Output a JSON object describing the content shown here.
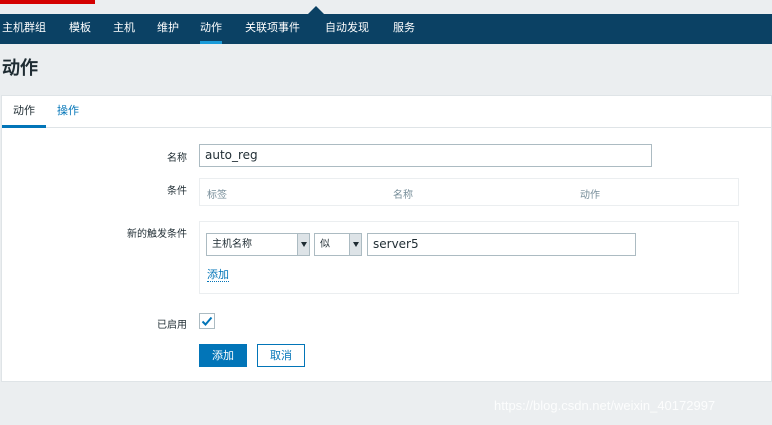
{
  "nav": {
    "items": [
      {
        "label": "主机群组",
        "active": false
      },
      {
        "label": "模板",
        "active": false
      },
      {
        "label": "主机",
        "active": false
      },
      {
        "label": "维护",
        "active": false
      },
      {
        "label": "动作",
        "active": true
      },
      {
        "label": "关联项事件",
        "active": false
      },
      {
        "label": "自动发现",
        "active": false
      },
      {
        "label": "服务",
        "active": false
      }
    ]
  },
  "page": {
    "title": "动作"
  },
  "tabs": [
    {
      "label": "动作",
      "active": true
    },
    {
      "label": "操作",
      "active": false
    }
  ],
  "form": {
    "name_label": "名称",
    "name_value": "auto_reg",
    "conditions_label": "条件",
    "conditions_columns": [
      "标签",
      "名称",
      "动作"
    ],
    "new_condition_label": "新的触发条件",
    "condition_type": "主机名称",
    "condition_operator": "似",
    "condition_value": "server5",
    "add_link": "添加",
    "enabled_label": "已启用",
    "enabled": true
  },
  "buttons": {
    "add": "添加",
    "cancel": "取消"
  },
  "watermark": "https://blog.csdn.net/weixin_40172997",
  "colors": {
    "nav_bg": "#0b4164",
    "accent": "#0275b8",
    "page_bg": "#ebeef0"
  }
}
